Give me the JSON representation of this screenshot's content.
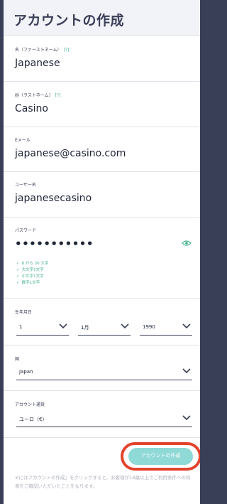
{
  "header": {
    "title": "アカウントの作成"
  },
  "form": {
    "first_name": {
      "label": "名（ファーストネーム）",
      "hint": "[?]",
      "value": "Japanese"
    },
    "last_name": {
      "label": "姓（ラストネーム）",
      "hint": "[?]",
      "value": "Casino"
    },
    "email": {
      "label": "Eメール",
      "value": "japanese@casino.com"
    },
    "username": {
      "label": "ユーザー名",
      "value": "japanesecasino"
    },
    "password": {
      "label": "パスワード",
      "value": "•••••••••••",
      "rules": [
        "8 から 30 文字",
        "大文字1文字",
        "小文字1文字",
        "数字1文字"
      ]
    },
    "birthdate": {
      "label": "生年月日",
      "day": "1",
      "month": "1月",
      "year": "1990"
    },
    "country": {
      "label": "国",
      "value": "Japan"
    },
    "currency": {
      "label": "アカウント通貨",
      "value": "ユーロ（€）"
    }
  },
  "submit": {
    "label": "アカウントの作成"
  },
  "terms": {
    "text": "※にはアカウントの作成』をクリックすると、お客様が18歳以上でご利用条件への同意をご確認いただいたことをなります。"
  },
  "colors": {
    "accent": "#43b08a",
    "button": "#8fd9d6",
    "highlight": "#e3442c",
    "border": "#3a3f58"
  }
}
